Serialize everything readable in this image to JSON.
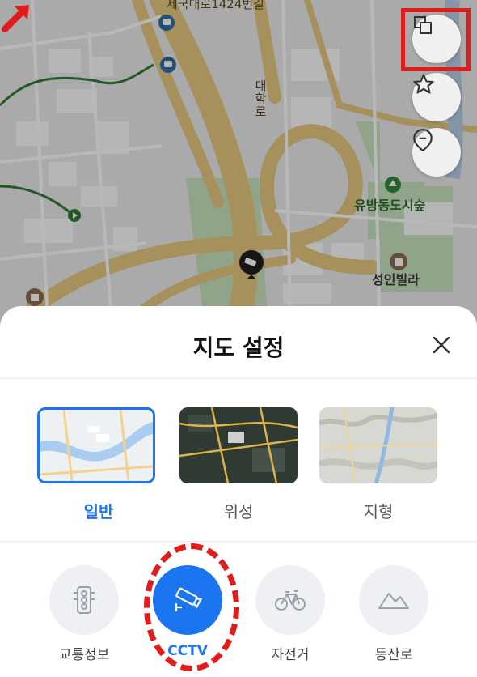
{
  "map": {
    "labels": {
      "top_road": "제국대로1424번길",
      "vertical_road": "대학로",
      "forest": "유방동도시숲",
      "villa": "성인빌라"
    },
    "buttons": [
      "layers-icon",
      "star-icon",
      "location-pin-icon"
    ]
  },
  "sheet": {
    "title": "지도 설정",
    "close_icon": "close-icon",
    "map_types": [
      {
        "label": "일반",
        "selected": true
      },
      {
        "label": "위성",
        "selected": false
      },
      {
        "label": "지형",
        "selected": false
      }
    ],
    "layers": [
      {
        "label": "교통정보",
        "icon": "traffic-light-icon",
        "on": false
      },
      {
        "label": "CCTV",
        "icon": "cctv-icon",
        "on": true
      },
      {
        "label": "자전거",
        "icon": "bicycle-icon",
        "on": false
      },
      {
        "label": "등산로",
        "icon": "mountain-icon",
        "on": false
      }
    ]
  },
  "colors": {
    "accent": "#1b74f0",
    "annotation_red": "#e21b1b",
    "road": "#e6c982",
    "park": "#bfe0b5"
  }
}
